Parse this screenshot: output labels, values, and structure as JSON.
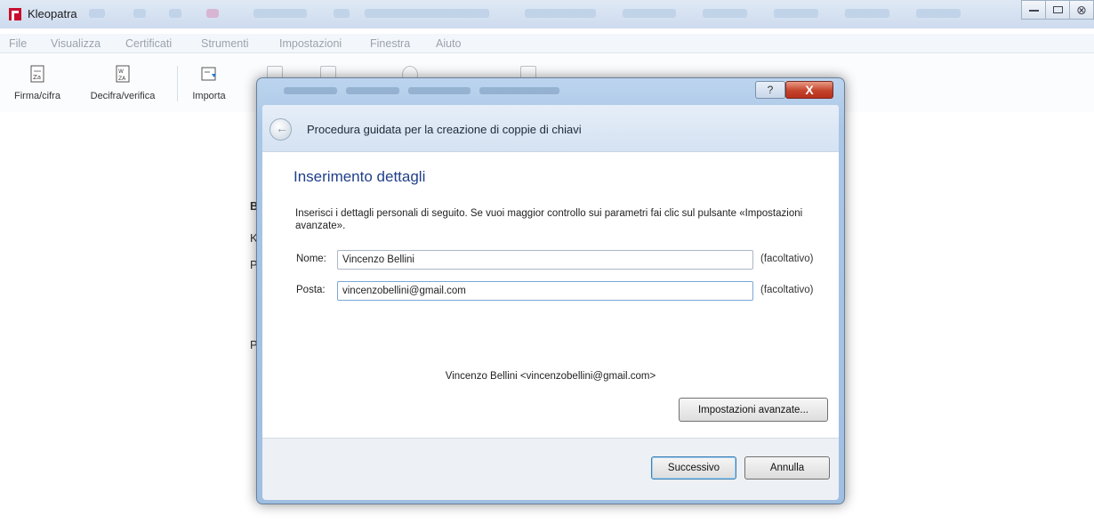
{
  "app": {
    "title": "Kleopatra",
    "accent_color": "#c8102e"
  },
  "menubar": {
    "items": [
      "File",
      "Visualizza",
      "Certificati",
      "Strumenti",
      "Impostazioni",
      "Finestra",
      "Aiuto"
    ]
  },
  "toolbar": {
    "sign_encrypt_label": "Firma/cifra",
    "decrypt_verify_label": "Decifra/verifica",
    "import_label": "Importa"
  },
  "background_fragments": [
    "B",
    "K",
    "P",
    "P"
  ],
  "dialog": {
    "help_label": "?",
    "close_label": "X",
    "heading": "Procedura guidata per la creazione di coppie di chiavi",
    "section_title": "Inserimento dettagli",
    "intro": "Inserisci i dettagli personali di seguito. Se vuoi maggior controllo sui parametri fai clic sul pulsante «Impostazioni avanzate».",
    "name_label": "Nome:",
    "name_value": "Vincenzo Bellini",
    "email_label": "Posta:",
    "email_value": "vincenzobellini@gmail.com",
    "optional_label": "(facoltativo)",
    "preview": "Vincenzo Bellini <vincenzobellini@gmail.com>",
    "advanced_button": "Impostazioni avanzate...",
    "next_button": "Successivo",
    "cancel_button": "Annulla"
  }
}
